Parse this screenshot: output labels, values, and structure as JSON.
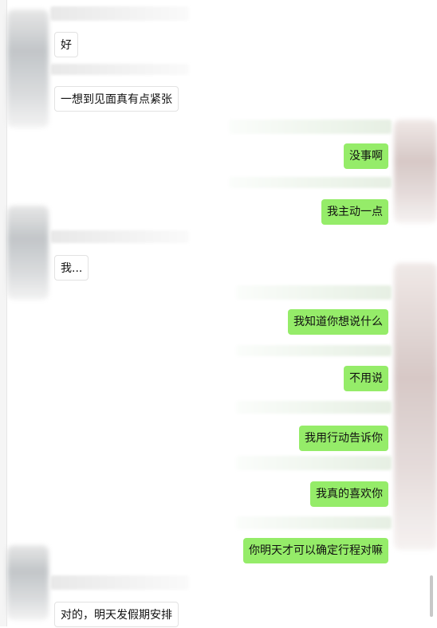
{
  "chat": {
    "messages": [
      {
        "side": "left",
        "text": "好"
      },
      {
        "side": "left",
        "text": "一想到见面真有点紧张"
      },
      {
        "side": "right",
        "text": "没事啊"
      },
      {
        "side": "right",
        "text": "我主动一点"
      },
      {
        "side": "left",
        "text": "我..."
      },
      {
        "side": "right",
        "text": "我知道你想说什么"
      },
      {
        "side": "right",
        "text": "不用说"
      },
      {
        "side": "right",
        "text": "我用行动告诉你"
      },
      {
        "side": "right",
        "text": "我真的喜欢你"
      },
      {
        "side": "right",
        "text": "你明天才可以确定行程对嘛"
      },
      {
        "side": "left",
        "text": "对的，明天发假期安排"
      }
    ]
  },
  "colors": {
    "bubble_sent": "#95ec69",
    "bubble_received": "#ffffff",
    "background": "#ffffff"
  }
}
